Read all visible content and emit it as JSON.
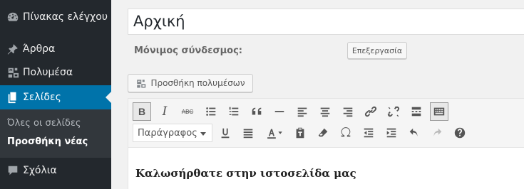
{
  "sidebar": {
    "items": [
      {
        "label": "Πίνακας ελέγχου",
        "icon": "dashboard-icon"
      },
      {
        "label": "Άρθρα",
        "icon": "pin-icon"
      },
      {
        "label": "Πολυμέσα",
        "icon": "media-icon"
      },
      {
        "label": "Σελίδες",
        "icon": "pages-icon",
        "current": true
      },
      {
        "label": "Σχόλια",
        "icon": "comments-icon"
      }
    ],
    "submenu": [
      {
        "label": "Όλες οι σελίδες"
      },
      {
        "label": "Προσθήκη νέας",
        "current": true
      }
    ]
  },
  "post": {
    "title": "Αρχική",
    "permalink_label": "Μόνιμος σύνδεσμος:",
    "edit_label": "Επεξεργασία",
    "add_media_label": "Προσθήκη πολυμέσων"
  },
  "editor": {
    "bold_label": "B",
    "italic_label": "I",
    "strike_label": "ABC",
    "format_value": "Παράγραφος",
    "content": "Καλωσήρθατε στην ιστοσελίδα μας"
  },
  "colors": {
    "sidebar_bg": "#23282d",
    "accent": "#0073aa"
  }
}
